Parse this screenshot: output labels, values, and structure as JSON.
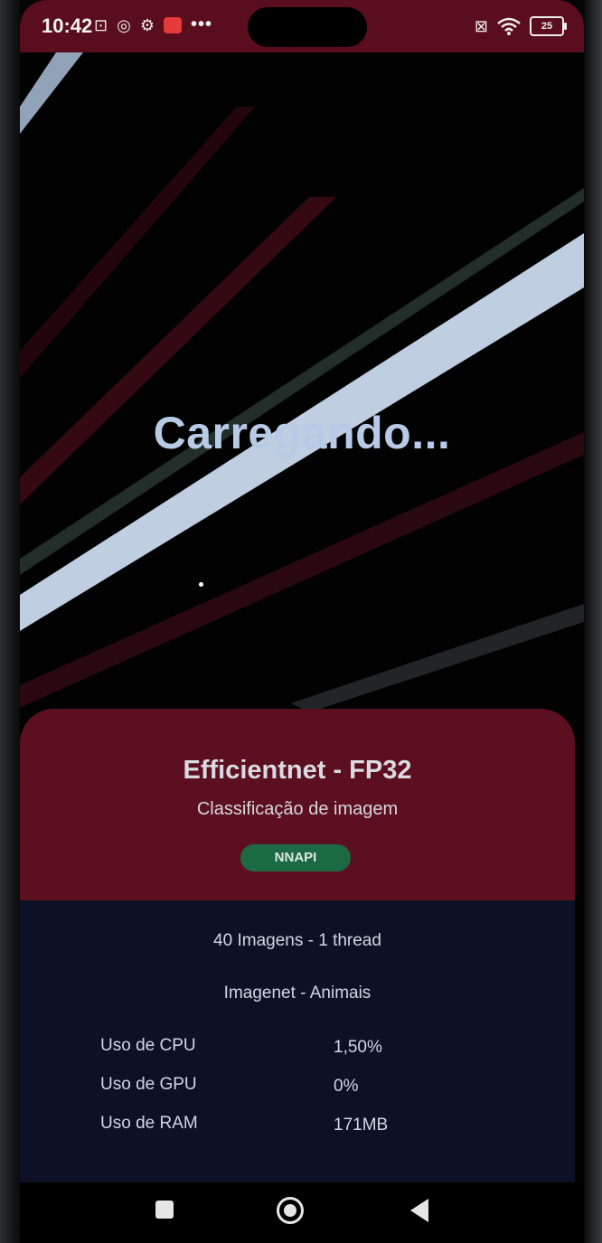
{
  "status_bar": {
    "time": "10:42",
    "battery_level": "25",
    "icons_left": [
      "nfc-icon",
      "data-saver-icon",
      "settings-icon",
      "mail-icon"
    ],
    "more_label": "•••",
    "icons_right": [
      "no-sim-icon",
      "wifi-icon",
      "battery-icon"
    ]
  },
  "screen": {
    "loading_text": "Carregando..."
  },
  "card": {
    "model_title": "Efficientnet - FP32",
    "task": "Classificação de imagem",
    "delegate_badge": "NNAPI",
    "images_info": "40 Imagens - 1 thread",
    "dataset": "Imagenet - Animais",
    "stats": [
      {
        "label": "Uso de CPU",
        "value": "1,50%"
      },
      {
        "label": "Uso de GPU",
        "value": "0%"
      },
      {
        "label": "Uso de RAM",
        "value": "171MB"
      }
    ]
  },
  "navigation": [
    "recent-apps-button",
    "home-button",
    "back-button"
  ],
  "colors": {
    "status_bar": "#5a0d1c",
    "card_header": "#5c101f",
    "card_body": "#0c1126",
    "badge": "#1c6a42",
    "loading_text": "#b7cbe6"
  }
}
